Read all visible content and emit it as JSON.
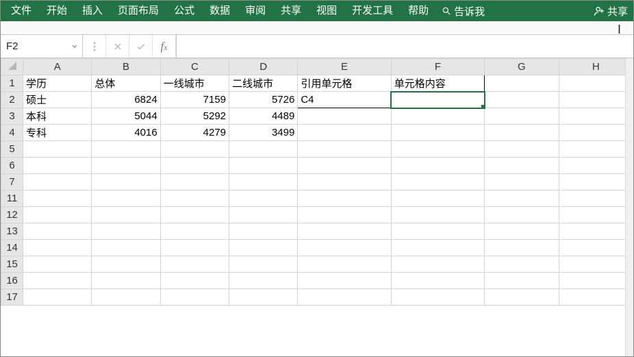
{
  "ribbon": {
    "tabs": [
      "文件",
      "开始",
      "插入",
      "页面布局",
      "公式",
      "数据",
      "审阅",
      "共享",
      "视图",
      "开发工具",
      "帮助"
    ],
    "tell_me": "告诉我",
    "share": "共享"
  },
  "formula_bar": {
    "name_box": "F2",
    "formula": ""
  },
  "sheet": {
    "columns": [
      "A",
      "B",
      "C",
      "D",
      "E",
      "F",
      "G",
      "H"
    ],
    "rows": [
      "1",
      "2",
      "3",
      "4",
      "5",
      "6",
      "7",
      "11",
      "12",
      "13",
      "14",
      "15",
      "16",
      "17"
    ],
    "active_cell": "F2",
    "cells": {
      "A1": "学历",
      "B1": "总体",
      "C1": "一线城市",
      "D1": "二线城市",
      "E1": "引用单元格",
      "F1": "单元格内容",
      "A2": "硕士",
      "B2": "6824",
      "C2": "7159",
      "D2": "5726",
      "E2": "C4",
      "F2": "",
      "A3": "本科",
      "B3": "5044",
      "C3": "5292",
      "D3": "4489",
      "A4": "专科",
      "B4": "4016",
      "C4": "4279",
      "D4": "3499"
    }
  },
  "chart_data": {
    "type": "table",
    "title": "",
    "columns": [
      "学历",
      "总体",
      "一线城市",
      "二线城市"
    ],
    "rows": [
      {
        "学历": "硕士",
        "总体": 6824,
        "一线城市": 7159,
        "二线城市": 5726
      },
      {
        "学历": "本科",
        "总体": 5044,
        "一线城市": 5292,
        "二线城市": 4489
      },
      {
        "学历": "专科",
        "总体": 4016,
        "一线城市": 4279,
        "二线城市": 3499
      }
    ],
    "aux": {
      "引用单元格": "C4",
      "单元格内容": ""
    }
  }
}
